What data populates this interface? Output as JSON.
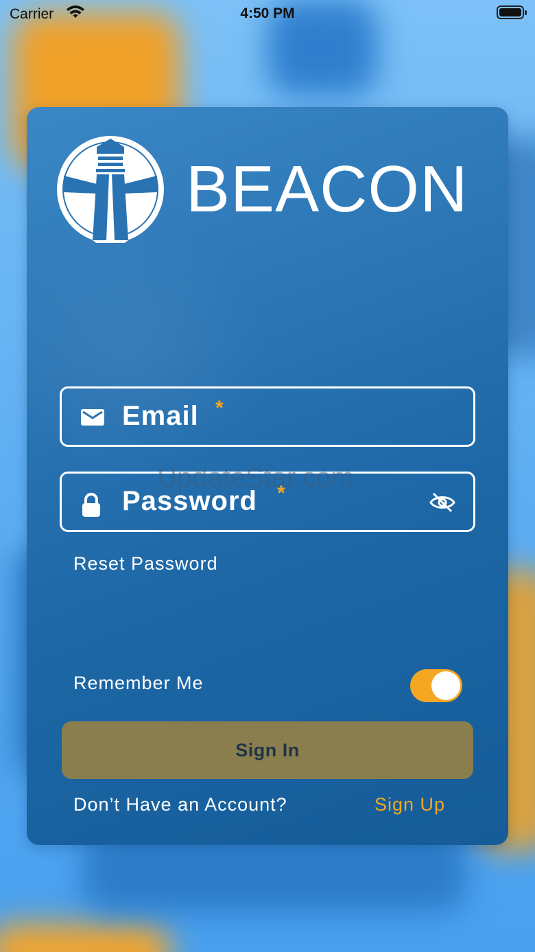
{
  "status_bar": {
    "carrier": "Carrier",
    "time": "4:50 PM"
  },
  "brand": {
    "name": "BEACON"
  },
  "form": {
    "email_label": "Email",
    "password_label": "Password",
    "required_marker": "*",
    "reset_password": "Reset Password",
    "remember_me": "Remember Me",
    "remember_me_on": true,
    "sign_in": "Sign In",
    "no_account": "Don’t Have an Account?",
    "sign_up": "Sign Up"
  },
  "watermark": "UpdateStar.com",
  "colors": {
    "accent": "#f5a623",
    "card": "#1d67a6",
    "button": "#8a7d4e"
  }
}
